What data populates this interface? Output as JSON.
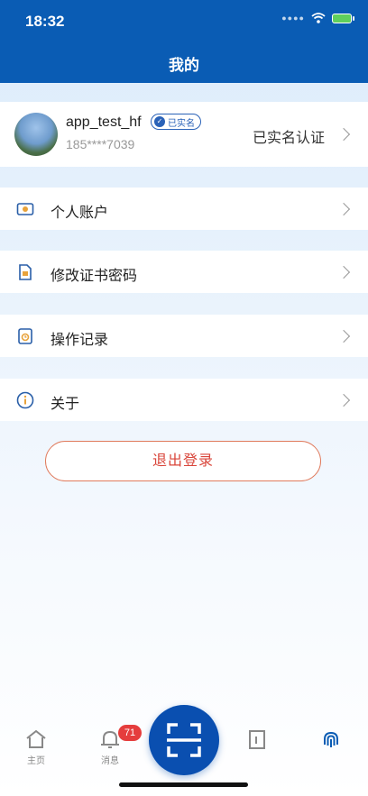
{
  "status_bar": {
    "time": "18:32"
  },
  "header": {
    "title": "我的"
  },
  "profile": {
    "username": "app_test_hf",
    "badge": "已实名",
    "phone": "185****7039",
    "verify_status": "已实名认证"
  },
  "menu": [
    {
      "label": "个人账户",
      "icon": "account-icon"
    },
    {
      "label": "修改证书密码",
      "icon": "certificate-icon"
    },
    {
      "label": "操作记录",
      "icon": "record-icon"
    },
    {
      "label": "关于",
      "icon": "info-icon"
    }
  ],
  "logout_label": "退出登录",
  "tabbar": {
    "home": "主页",
    "messages": "消息",
    "messages_badge": "71"
  },
  "colors": {
    "primary": "#0a5cb4",
    "danger": "#d9453a",
    "badge": "#e53d3d"
  }
}
